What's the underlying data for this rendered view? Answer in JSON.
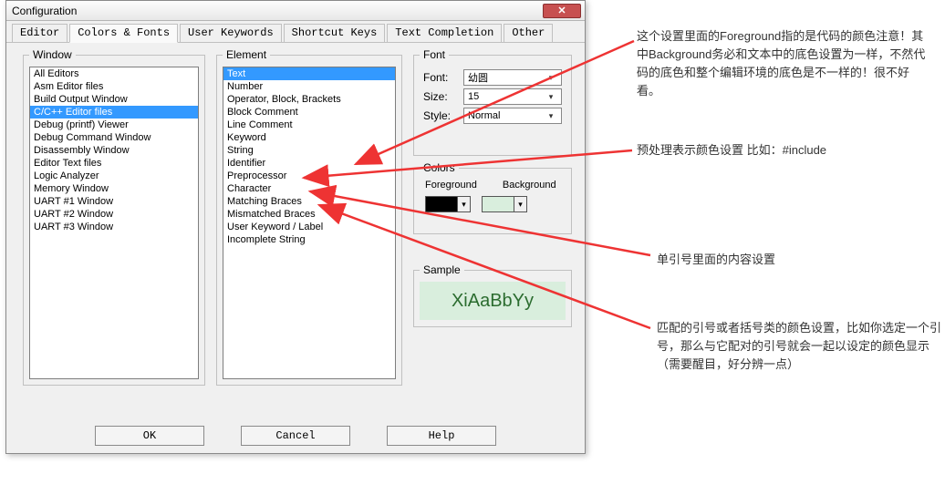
{
  "dialog": {
    "title": "Configuration",
    "tabs": [
      "Editor",
      "Colors & Fonts",
      "User Keywords",
      "Shortcut Keys",
      "Text Completion",
      "Other"
    ],
    "active_tab": 1
  },
  "window": {
    "legend": "Window",
    "items": [
      "All Editors",
      "Asm Editor files",
      "Build Output Window",
      "C/C++ Editor files",
      "Debug (printf) Viewer",
      "Debug Command Window",
      "Disassembly Window",
      "Editor Text files",
      "Logic Analyzer",
      "Memory Window",
      "UART #1 Window",
      "UART #2 Window",
      "UART #3 Window"
    ],
    "selected": 3
  },
  "element": {
    "legend": "Element",
    "items": [
      "Text",
      "Number",
      "Operator, Block, Brackets",
      "Block Comment",
      "Line Comment",
      "Keyword",
      "String",
      "Identifier",
      "Preprocessor",
      "Character",
      "Matching Braces",
      "Mismatched Braces",
      "User Keyword / Label",
      "Incomplete String"
    ],
    "selected": 0
  },
  "font": {
    "legend": "Font",
    "font_label": "Font:",
    "font_value": "幼圆",
    "size_label": "Size:",
    "size_value": "15",
    "style_label": "Style:",
    "style_value": "Normal"
  },
  "colors": {
    "legend": "Colors",
    "fg_label": "Foreground",
    "bg_label": "Background",
    "fg_value": "#000000",
    "bg_value": "#d9eedd"
  },
  "sample": {
    "legend": "Sample",
    "text": "XiAaBbYy"
  },
  "buttons": {
    "ok": "OK",
    "cancel": "Cancel",
    "help": "Help"
  },
  "annotations": {
    "a1": "这个设置里面的Foreground指的是代码的颜色注意！其中Background务必和文本中的底色设置为一样，不然代码的底色和整个编辑环境的底色是不一样的！很不好看。",
    "a2": "预处理表示颜色设置  比如：#include",
    "a3": "单引号里面的内容设置",
    "a4": "匹配的引号或者括号类的颜色设置，比如你选定一个引号，那么与它配对的引号就会一起以设定的颜色显示（需要醒目，好分辨一点）"
  }
}
